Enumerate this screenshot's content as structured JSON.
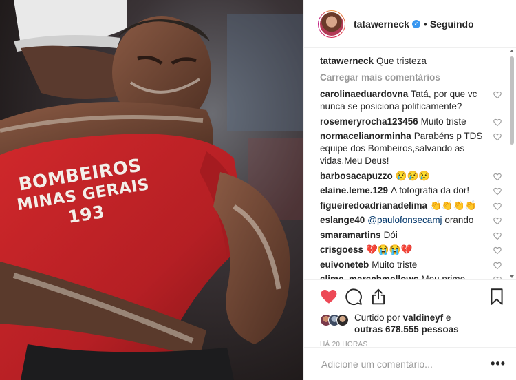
{
  "post": {
    "image_alt": "Bombeiro abraçando homem",
    "jersey": {
      "line1": "BOMBEIROS",
      "line2": "MINAS GERAIS",
      "line3": "193"
    }
  },
  "header": {
    "username": "tatawerneck",
    "verified_icon": "verified-badge-icon",
    "separator": "•",
    "follow_status": "Seguindo"
  },
  "caption": {
    "author": "tatawerneck",
    "text": "Que tristeza"
  },
  "load_more_label": "Carregar mais comentários",
  "comments": [
    {
      "author": "carolinaeduardovna",
      "text": "Tatá, por que vc nunca se posiciona politicamente?"
    },
    {
      "author": "rosemeryrocha123456",
      "text": "Muito triste"
    },
    {
      "author": "normacelianorminha",
      "text": "Parabéns p TDS equipe dos Bombeiros,salvando as vidas.Meu Deus!"
    },
    {
      "author": "barbosacapuzzo",
      "text": "😢😢😢"
    },
    {
      "author": "elaine.leme.129",
      "text": "A fotografia da dor!"
    },
    {
      "author": "figueiredoadrianadelima",
      "text": "👏👏👏👏"
    },
    {
      "author": "eslange40",
      "mention": "@paulofonsecamj",
      "text": "orando"
    },
    {
      "author": "smaramartins",
      "text": "Dói"
    },
    {
      "author": "crisgoess",
      "text": "💔😭😭💔"
    },
    {
      "author": "euivoneteb",
      "text": "Muito triste"
    },
    {
      "author": "slime_marschmellows",
      "text": "Meu primo"
    }
  ],
  "actions": {
    "like_icon": "heart-filled-icon",
    "comment_icon": "comment-bubble-icon",
    "share_icon": "share-icon",
    "save_icon": "bookmark-icon",
    "like_color": "#ed4956"
  },
  "likes": {
    "prefix": "Curtido por",
    "first_user": "valdineyf",
    "conjunction": "e",
    "others": "outras 678.555 pessoas"
  },
  "timestamp": "HÁ 20 HORAS",
  "add_comment": {
    "placeholder": "Adicione um comentário...",
    "more_label": "•••"
  }
}
